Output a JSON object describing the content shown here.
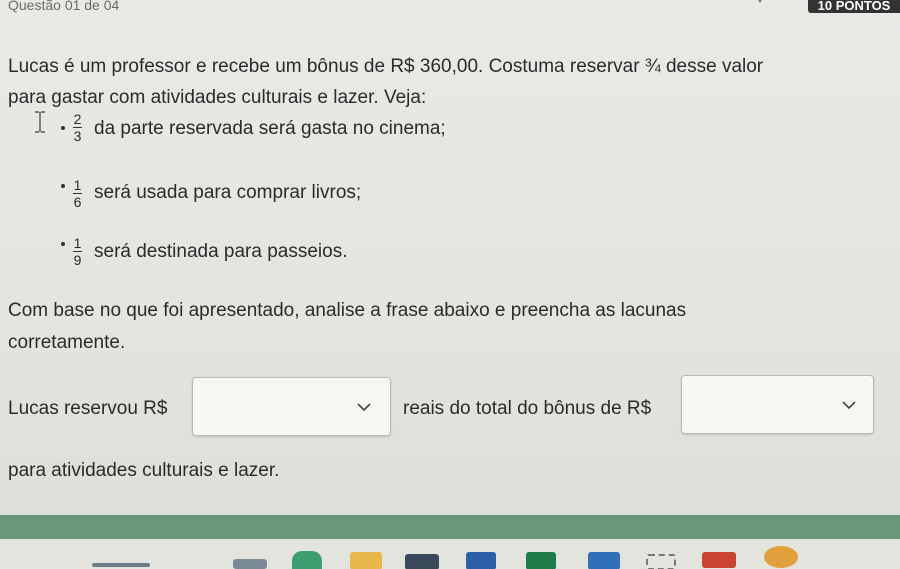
{
  "header": {
    "question_label": "Questão 01 de 04",
    "points_label": "10 PONTOS",
    "star": "*"
  },
  "intro": {
    "line1": "Lucas é um professor e recebe um bônus de R$ 360,00. Costuma reservar ¾ desse valor",
    "line2": "para gastar com atividades culturais e lazer. Veja:"
  },
  "items": [
    {
      "numerator": "2",
      "denominator": "3",
      "text": "da parte reservada será gasta no cinema;"
    },
    {
      "numerator": "1",
      "denominator": "6",
      "text": "será usada para comprar livros;"
    },
    {
      "numerator": "1",
      "denominator": "9",
      "text": "será destinada para passeios."
    }
  ],
  "instruction": {
    "line1": "Com base no que foi apresentado, analise a frase abaixo e preencha as lacunas",
    "line2": "corretamente."
  },
  "sentence": {
    "part1": "Lucas reservou R$",
    "part2": "reais do total do bônus de R$",
    "part3": "para atividades culturais e lazer.",
    "select1_value": "",
    "select2_value": ""
  },
  "colors": {
    "points_badge": "#333333",
    "taskbar_accent": "#6a977a",
    "text": "#2b2b2b"
  },
  "icons": [
    "text-cursor-icon",
    "chevron-down-icon",
    "taskbar-app-icons"
  ]
}
